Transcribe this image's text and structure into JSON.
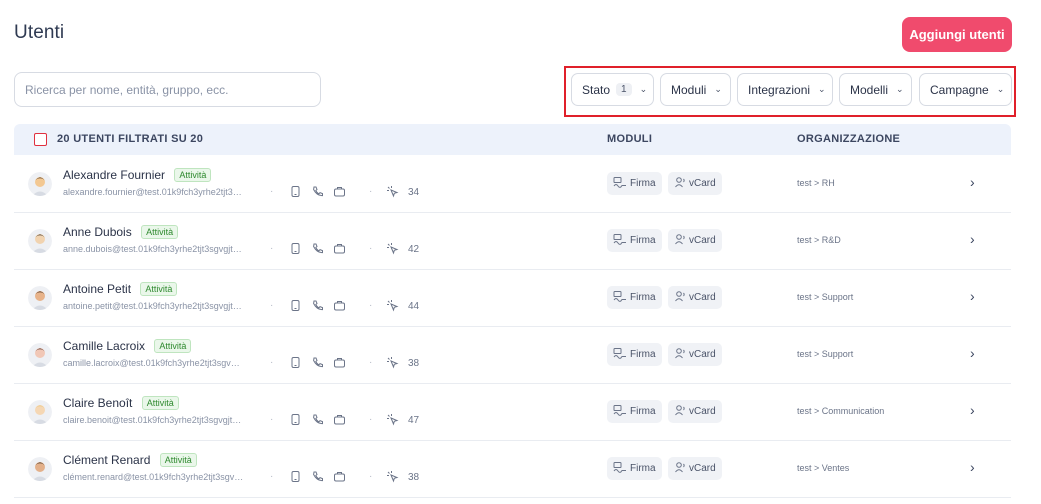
{
  "page": {
    "title": "Utenti",
    "add_button": "Aggiungi utenti"
  },
  "search": {
    "placeholder": "Ricerca per nome, entità, gruppo, ecc."
  },
  "filters": [
    {
      "label": "Stato",
      "count": "1"
    },
    {
      "label": "Moduli"
    },
    {
      "label": "Integrazioni"
    },
    {
      "label": "Modelli"
    },
    {
      "label": "Campagne"
    }
  ],
  "table": {
    "selection_label": "20 UTENTI FILTRATI SU 20",
    "col_modules": "MODULI",
    "col_org": "ORGANIZZAZIONE",
    "module_labels": {
      "firma": "Firma",
      "vcard": "vCard"
    },
    "rows": [
      {
        "name": "Alexandre Fournier",
        "status": "Attività",
        "email": "alexandre.fournier@test.01k9fch3yrhe2tjt3…",
        "count": "34",
        "org": "test > RH"
      },
      {
        "name": "Anne Dubois",
        "status": "Attività",
        "email": "anne.dubois@test.01k9fch3yrhe2tjt3sgvgjt…",
        "count": "42",
        "org": "test > R&D"
      },
      {
        "name": "Antoine Petit",
        "status": "Attività",
        "email": "antoine.petit@test.01k9fch3yrhe2tjt3sgvgjt…",
        "count": "44",
        "org": "test > Support"
      },
      {
        "name": "Camille Lacroix",
        "status": "Attività",
        "email": "camille.lacroix@test.01k9fch3yrhe2tjt3sgv…",
        "count": "38",
        "org": "test > Support"
      },
      {
        "name": "Claire Benoît",
        "status": "Attività",
        "email": "claire.benoit@test.01k9fch3yrhe2tjt3sgvgjt…",
        "count": "47",
        "org": "test > Communication"
      },
      {
        "name": "Clément Renard",
        "status": "Attività",
        "email": "clément.renard@test.01k9fch3yrhe2tjt3sgv…",
        "count": "38",
        "org": "test > Ventes"
      }
    ]
  },
  "colors": {
    "accent": "#f04b6d",
    "highlight_border": "#e0202a",
    "header_bg": "#edf2fb",
    "badge_green": "#2f8a2f"
  },
  "icons": [
    "checkbox-icon",
    "chevron-down-icon",
    "device-icon",
    "phone-icon",
    "briefcase-icon",
    "pointer-click-icon",
    "signature-icon",
    "vcard-icon",
    "chevron-right-icon"
  ]
}
